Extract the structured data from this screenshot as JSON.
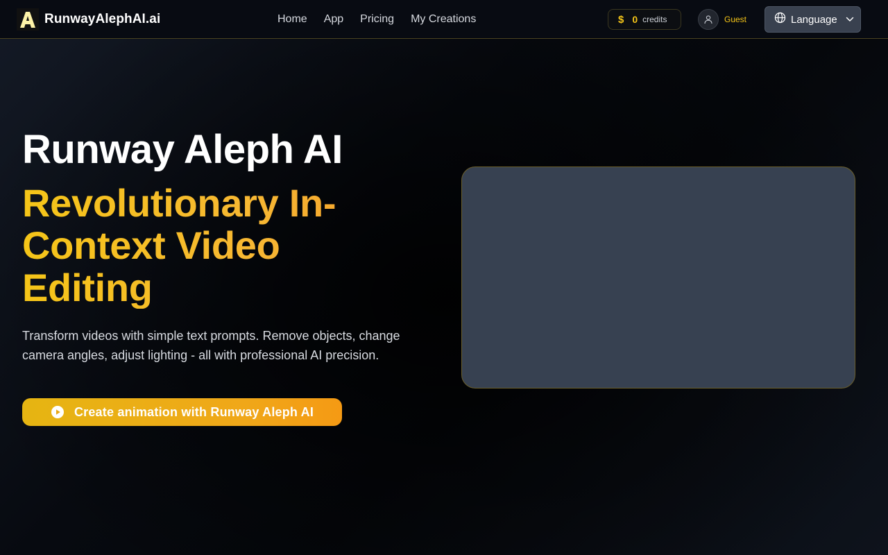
{
  "header": {
    "logo_text": "RunwayAlephAI.ai",
    "nav": [
      {
        "label": "Home"
      },
      {
        "label": "App"
      },
      {
        "label": "Pricing"
      },
      {
        "label": "My Creations"
      }
    ],
    "credits": {
      "symbol": "$",
      "count": "0",
      "label": "credits"
    },
    "user": {
      "label": "Guest"
    },
    "language": {
      "label": "Language"
    }
  },
  "hero": {
    "title": "Runway Aleph AI",
    "subtitle": "Revolutionary In-Context Video Editing",
    "description": "Transform videos with simple text prompts. Remove objects, change camera angles, adjust lighting - all with professional AI precision.",
    "cta_label": "Create animation with Runway Aleph AI"
  },
  "colors": {
    "accent": "#f5c518",
    "video_placeholder": "#374151",
    "language_button": "#39414f"
  }
}
